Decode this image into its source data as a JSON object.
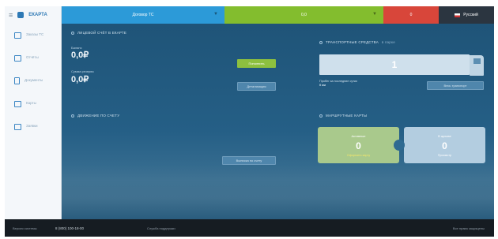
{
  "sidebar": {
    "brand": "ЕКАРТА",
    "items": [
      {
        "label": "Заказы ТС",
        "icon": "truck-icon"
      },
      {
        "label": "Отчёты",
        "icon": "report-icon"
      },
      {
        "label": "Документы",
        "icon": "document-icon"
      },
      {
        "label": "Карты",
        "icon": "card-icon"
      },
      {
        "label": "Заявки",
        "icon": "chat-icon"
      }
    ]
  },
  "topbar": {
    "account": "Договор ТС",
    "balance": "0,0",
    "alert": "0",
    "language": "Русский"
  },
  "personal_account": {
    "title": "ЛИЦЕВОЙ СЧЁТ В ЕКАРТЕ",
    "balance_label": "Баланс",
    "balance_value": "0,0₽",
    "reserve_label": "Сумма резерва",
    "reserve_value": "0,0₽",
    "topup_button": "Пополнить",
    "details_button": "Детализация"
  },
  "movements": {
    "title": "ДВИЖЕНИЕ ПО СЧЕТУ",
    "button": "Выписка по счету"
  },
  "vehicles": {
    "title": "ТРАНСПОРТНЫЕ СРЕДСТВА",
    "subtitle": "в парке",
    "count": "1",
    "note_line1": "Пробег за последние сутки",
    "note_line2": "0 км",
    "button": "Весь транспорт"
  },
  "route_cards": {
    "title": "МАРШРУТНЫЕ КАРТЫ",
    "active_label": "Активные",
    "active_count": "0",
    "active_link": "Оформить карту",
    "archive_label": "В архиве",
    "archive_count": "0",
    "archive_link": "Просмотр"
  },
  "footer": {
    "version": "Версия системы",
    "phone": "8 (800) 100-18-00",
    "support": "Служба поддержки",
    "copyright": "Все права защищены"
  },
  "colors": {
    "blue": "#2c9ad8",
    "green": "#83bd2e",
    "red": "#d8463a",
    "dark": "#2b3540",
    "content_bg": "#1f5478"
  }
}
